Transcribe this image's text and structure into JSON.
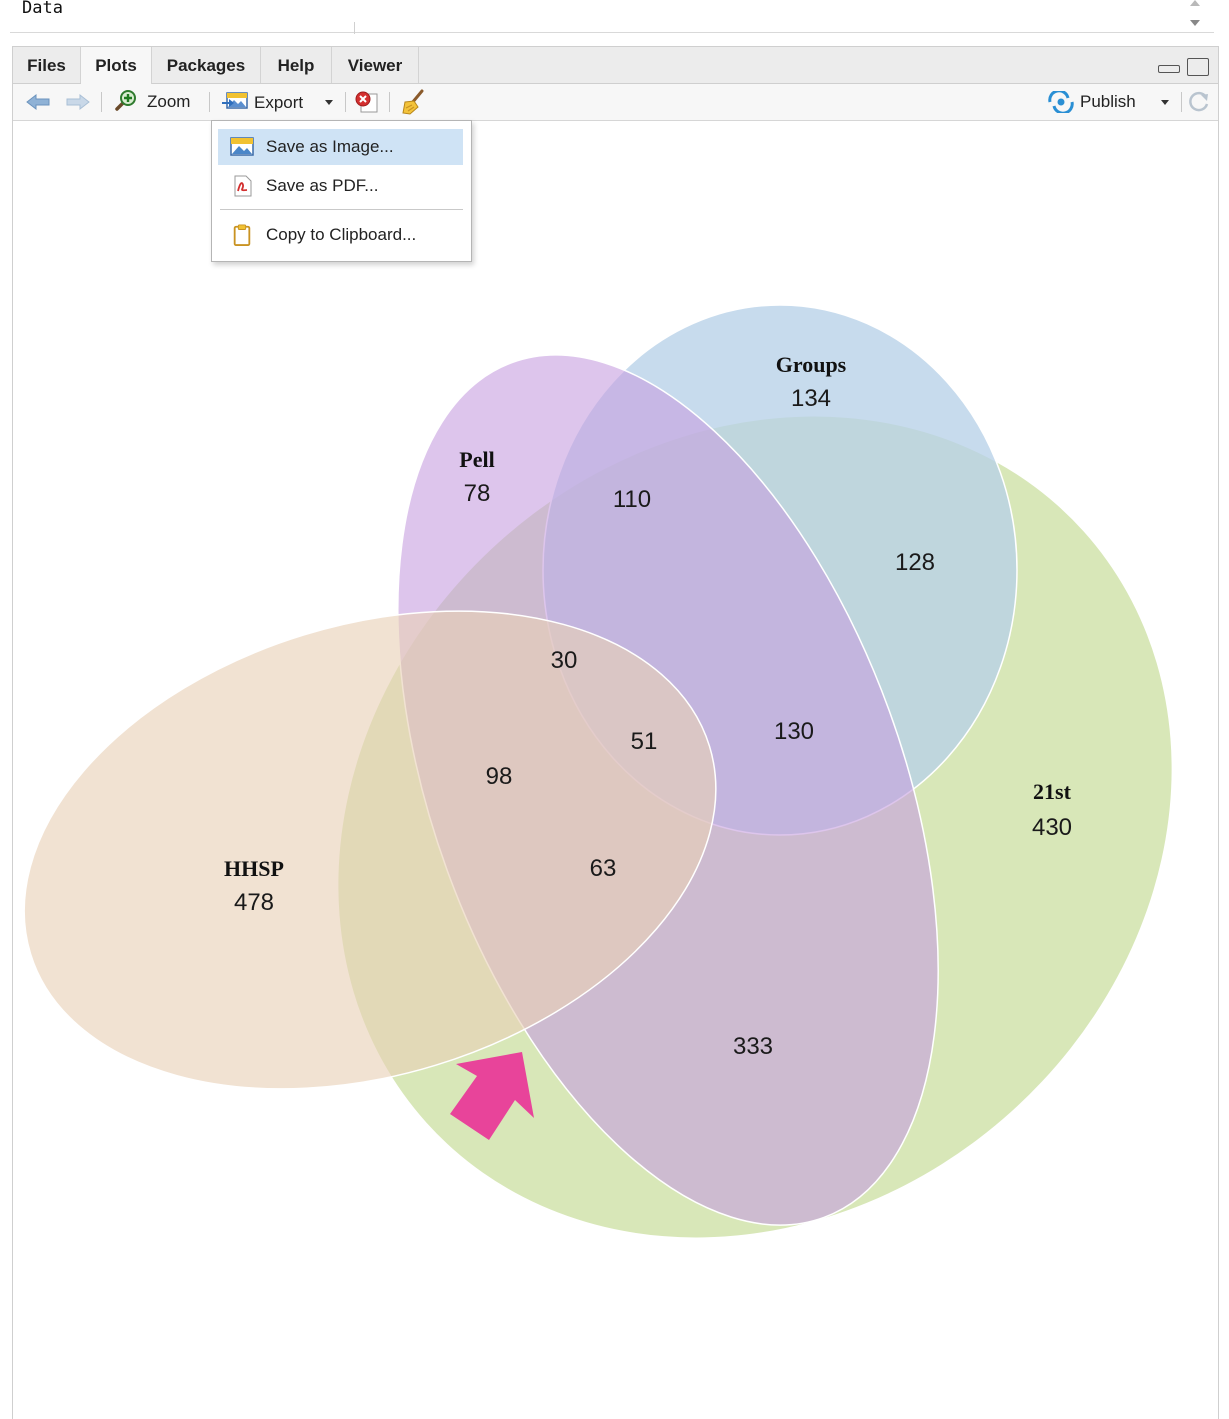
{
  "env": {
    "label": "Data"
  },
  "tabs": [
    {
      "label": "Files"
    },
    {
      "label": "Plots"
    },
    {
      "label": "Packages"
    },
    {
      "label": "Help"
    },
    {
      "label": "Viewer"
    }
  ],
  "toolbar": {
    "zoom_label": "Zoom",
    "export_label": "Export",
    "publish_label": "Publish"
  },
  "export_menu": {
    "items": [
      {
        "label": "Save as Image...",
        "icon": "image-icon",
        "highlighted": true
      },
      {
        "label": "Save as PDF...",
        "icon": "pdf-icon",
        "highlighted": false
      },
      {
        "label": "Copy to Clipboard...",
        "icon": "clipboard-icon",
        "highlighted": false
      }
    ]
  },
  "venn": {
    "sets": [
      {
        "name": "Pell",
        "count": "78",
        "color": "#c79fdf"
      },
      {
        "name": "Groups",
        "count": "134",
        "color": "#b7d1e8"
      },
      {
        "name": "21st",
        "count": "430",
        "color": "#d8e7b8"
      },
      {
        "name": "HHSP",
        "count": "478",
        "color": "#e8d0b6"
      }
    ],
    "regions": [
      {
        "sets": [
          "Pell",
          "Groups"
        ],
        "count": "110"
      },
      {
        "sets": [
          "Groups",
          "21st"
        ],
        "count": "128"
      },
      {
        "sets": [
          "Pell",
          "Groups",
          "HHSP"
        ],
        "count": "30"
      },
      {
        "sets": [
          "Pell",
          "Groups",
          "21st",
          "HHSP"
        ],
        "count": "51"
      },
      {
        "sets": [
          "Pell",
          "Groups",
          "21st"
        ],
        "count": "130"
      },
      {
        "sets": [
          "Pell",
          "HHSP"
        ],
        "count": "98"
      },
      {
        "sets": [
          "Pell",
          "21st",
          "HHSP"
        ],
        "count": "63"
      },
      {
        "sets": [
          "Pell",
          "21st"
        ],
        "count": "333"
      }
    ]
  },
  "annotation": {
    "color": "#e8449a",
    "icon": "pointer-arrow-icon"
  }
}
